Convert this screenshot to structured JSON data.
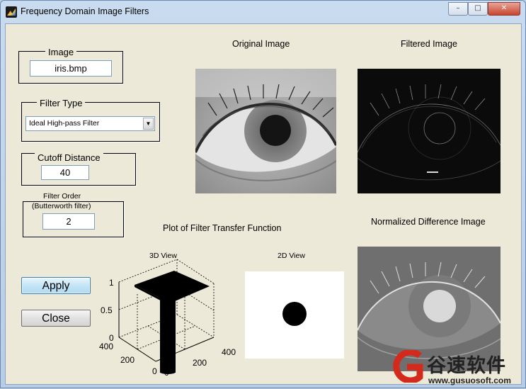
{
  "window": {
    "title": "Frequency Domain Image Filters"
  },
  "controls": {
    "minimize": "–",
    "maximize": "□",
    "close": "✕"
  },
  "image_group": {
    "title": "Image",
    "value": "iris.bmp"
  },
  "filter_type_group": {
    "title": "Filter Type",
    "selected": "Ideal High-pass Filter"
  },
  "cutoff_group": {
    "title": "Cutoff Distance",
    "value": "40"
  },
  "order_group": {
    "title_line1": "Filter Order",
    "title_line2": "(Butterworth filter)",
    "value": "2"
  },
  "buttons": {
    "apply": "Apply",
    "close": "Close"
  },
  "images": {
    "original_title": "Original Image",
    "filtered_title": "Filtered Image",
    "difference_title": "Normalized Difference Image"
  },
  "plot": {
    "title": "Plot of Filter Transfer Function",
    "view3d_title": "3D View",
    "view2d_title": "2D View",
    "z_ticks": [
      "1",
      "0.5",
      "0"
    ],
    "x_ticks": [
      "400",
      "200",
      "0"
    ],
    "y_ticks": [
      "0",
      "200",
      "400"
    ]
  },
  "watermark": {
    "text": "谷速软件",
    "url": "www.gusuosoft.com"
  }
}
